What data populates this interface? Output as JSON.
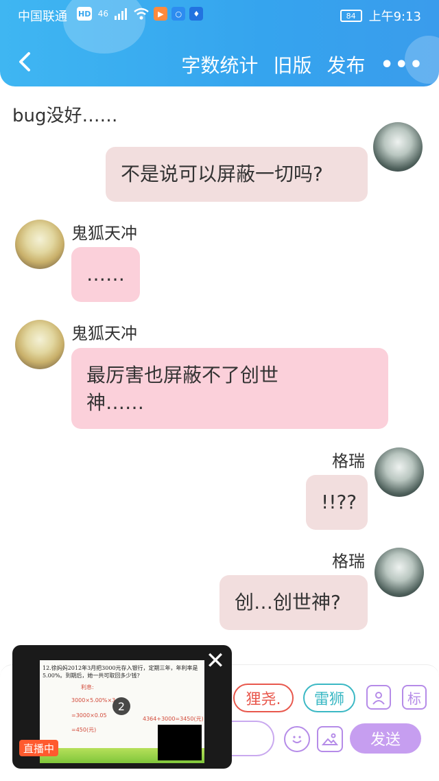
{
  "status_bar": {
    "carrier": "中国联通",
    "hd": "HD",
    "network": "46",
    "battery": "84",
    "time": "上午9:13"
  },
  "nav": {
    "back_icon": "chevron-left-icon",
    "word_count": "字数统计",
    "old_version": "旧版",
    "publish": "发布",
    "more": "•••"
  },
  "chat": {
    "system_text": "bug没好……",
    "messages": [
      {
        "side": "right",
        "avatar": "gray",
        "name": "",
        "text": "不是说可以屏蔽一切吗?"
      },
      {
        "side": "left",
        "avatar": "fox",
        "name": "鬼狐天冲",
        "text": "……"
      },
      {
        "side": "left",
        "avatar": "fox",
        "name": "鬼狐天冲",
        "text_line1": "最厉害也屏蔽不了创世",
        "text_line2": "神……"
      },
      {
        "side": "right",
        "avatar": "gray",
        "name": "格瑞",
        "text": "!!??"
      },
      {
        "side": "right",
        "avatar": "gray",
        "name": "格瑞",
        "text": "创…创世神?"
      }
    ]
  },
  "input_area": {
    "chips": [
      "狸尧.",
      "雷狮"
    ],
    "mark_label": "标",
    "send_label": "发送"
  },
  "float_window": {
    "close": "✕",
    "live_label": "直播中",
    "page_number": "2",
    "question": "12.徐妈妈2012年3月把3000元存入银行，定期三年，年利率是5.00%。到期后，她一共可取回多少钱?",
    "handwriting": [
      "利息:",
      "3000×5.00%×3",
      "=3000×0.05",
      "=450(元)",
      "4364+3000=3450(元)"
    ]
  }
}
